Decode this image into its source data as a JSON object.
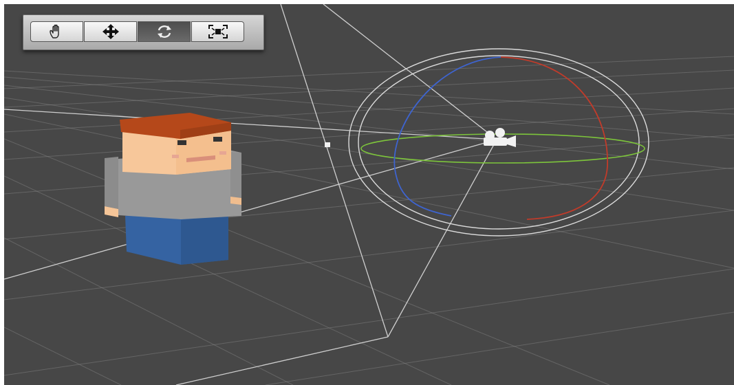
{
  "viewport": {
    "background": "#474747",
    "grid_color": "#8a8a8a"
  },
  "toolbar": {
    "tools": [
      {
        "name": "pan",
        "icon": "hand-icon",
        "active": false
      },
      {
        "name": "move",
        "icon": "move-arrows-icon",
        "active": false
      },
      {
        "name": "orbit",
        "icon": "rotate-icon",
        "active": true
      },
      {
        "name": "frame",
        "icon": "frame-selection-icon",
        "active": false
      }
    ]
  },
  "scene": {
    "character_colors": {
      "hair": "#b04a1a",
      "skin": "#f5c598",
      "shirt": "#9a9a9a",
      "pants": "#2f63a0"
    },
    "gizmo_colors": {
      "x_axis": "#c23b2a",
      "y_axis": "#7dc53b",
      "z_axis": "#3e64d0",
      "outer": "#e6e6e6"
    },
    "camera_icon": "camera-icon"
  }
}
